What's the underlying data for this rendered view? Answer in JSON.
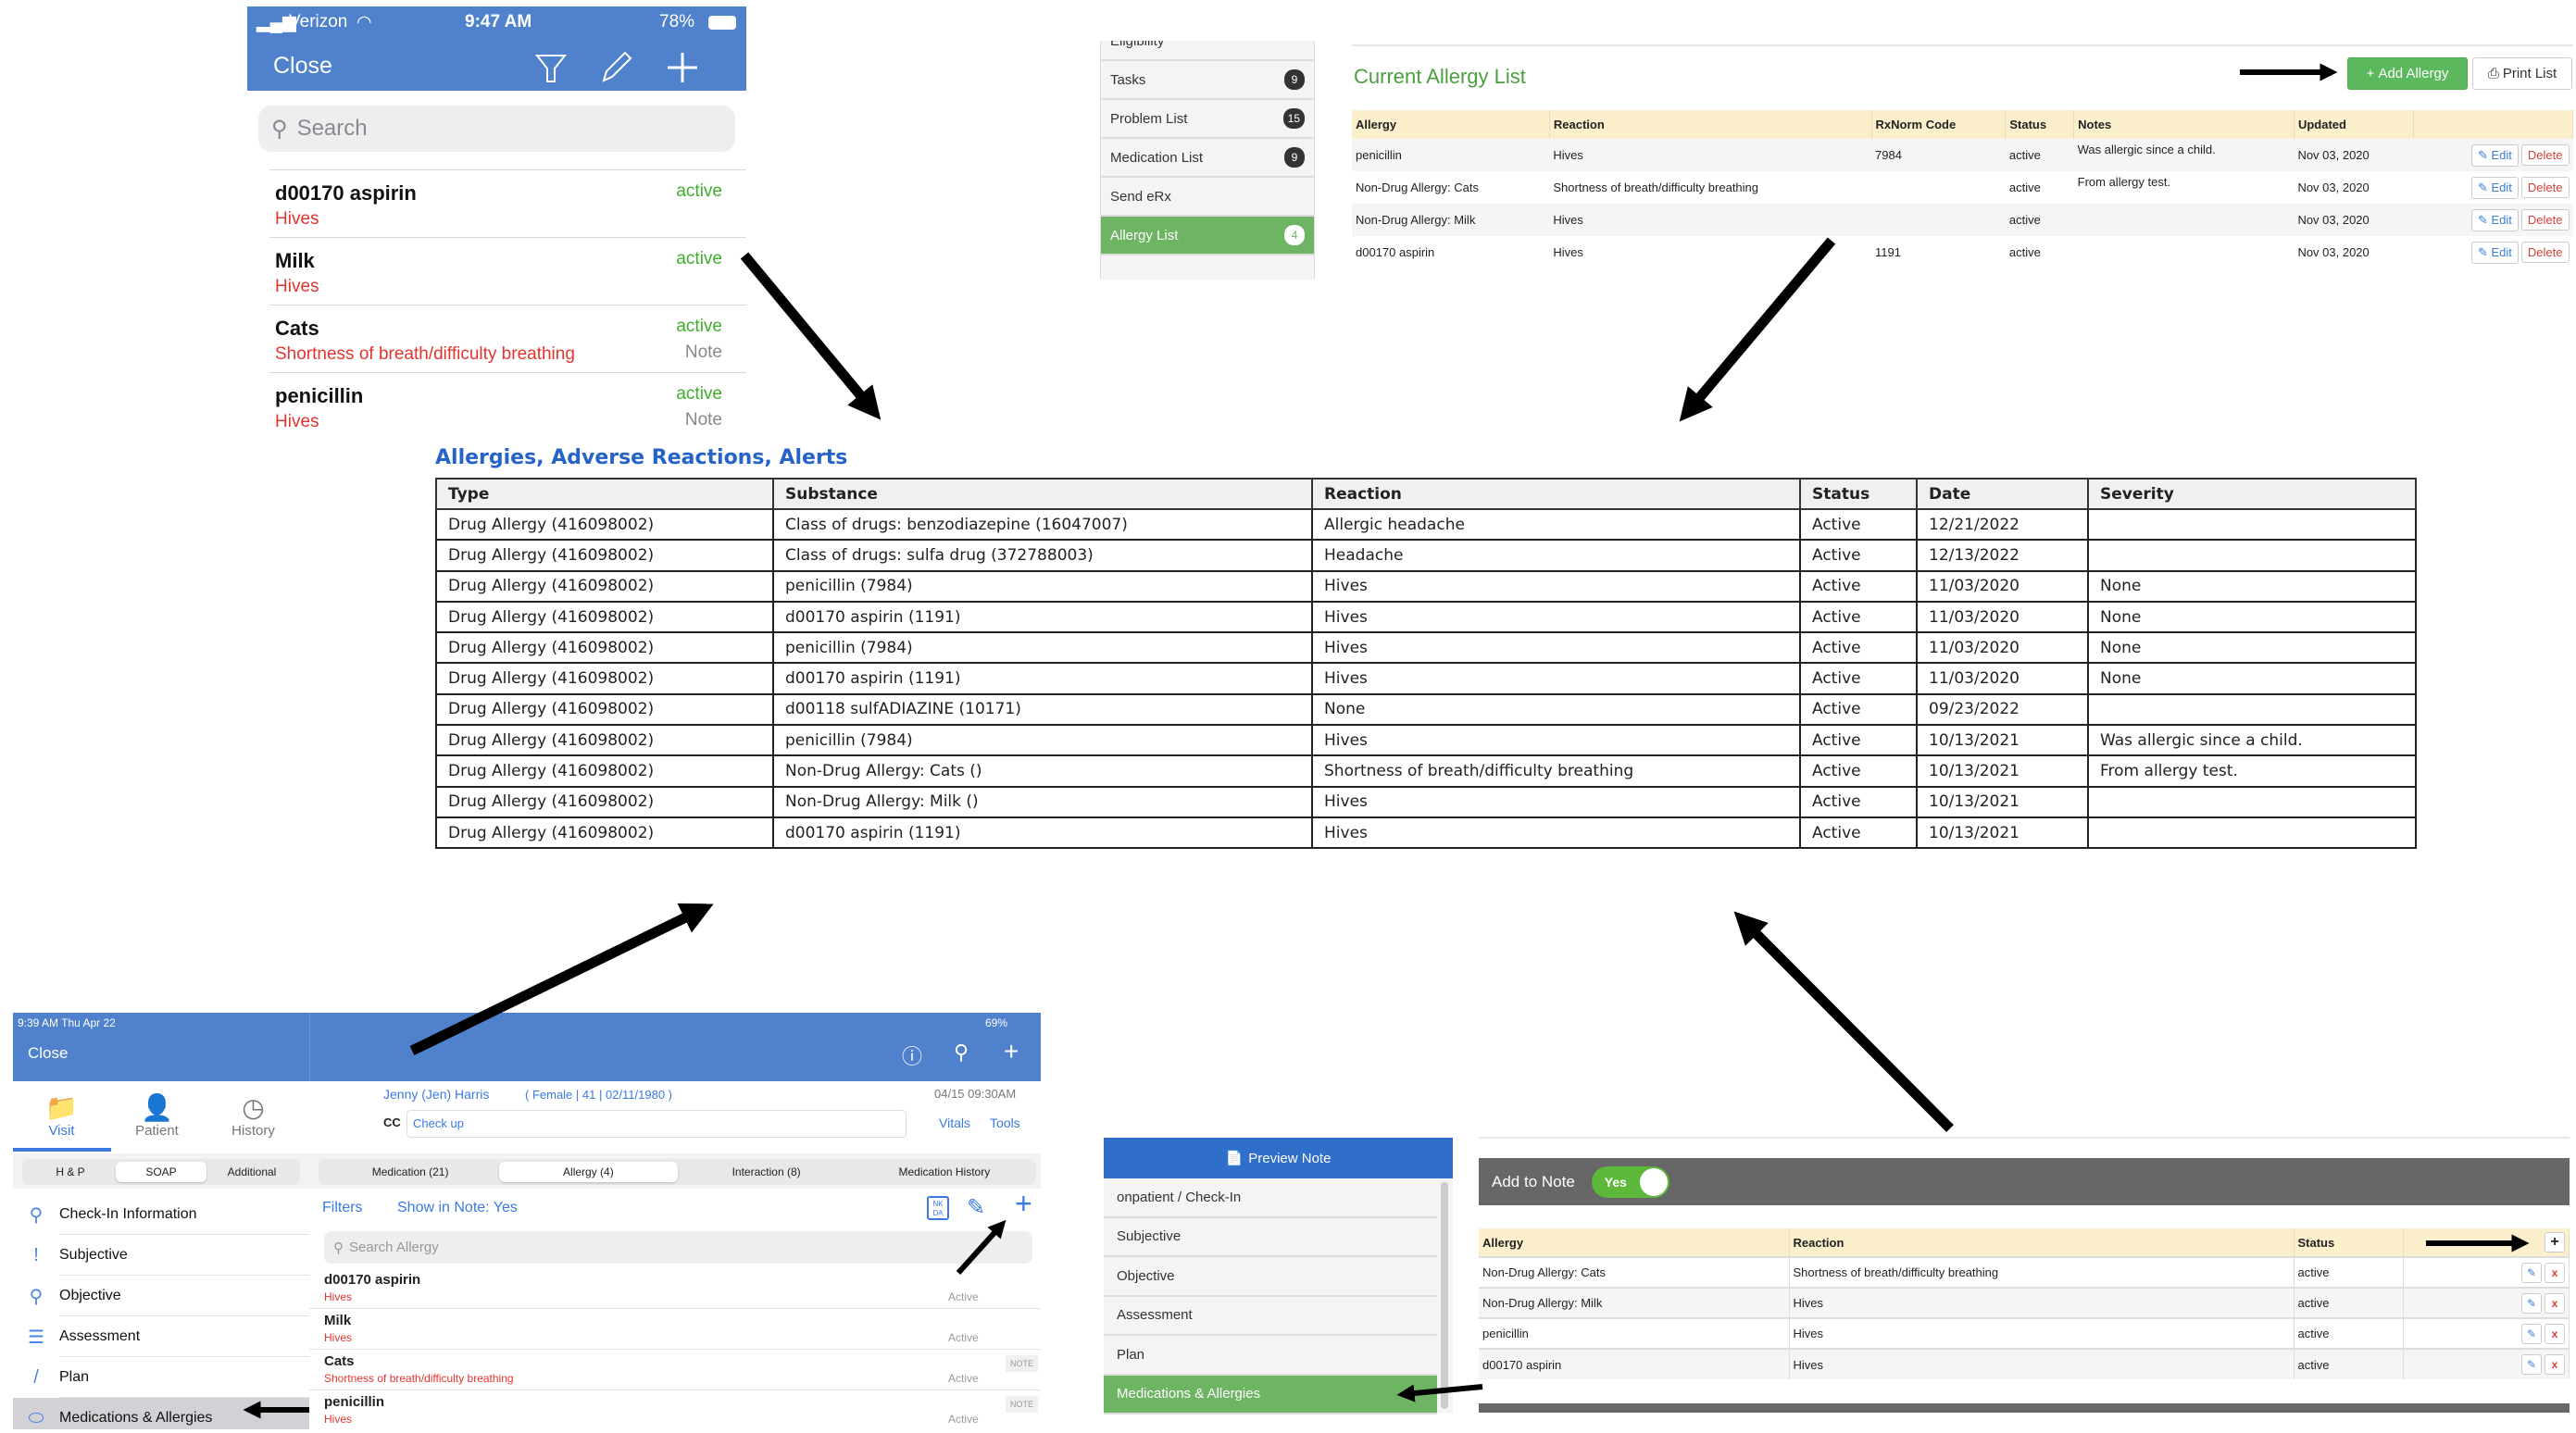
{
  "colors": {
    "ios_blue": "#4f81cc",
    "active_green": "#3fae2a",
    "reaction_red": "#e3342f",
    "web_green": "#6db463",
    "header_yellow": "#fcefcb",
    "link_blue": "#2563c9"
  },
  "phone": {
    "carrier": "Verizon",
    "time": "9:47 AM",
    "battery": "78%",
    "close": "Close",
    "icons": [
      "filter-icon",
      "pencil-icon",
      "plus-icon"
    ],
    "search_placeholder": "Search",
    "items": [
      {
        "name": "d00170 aspirin",
        "reaction": "Hives",
        "status": "active",
        "note": ""
      },
      {
        "name": "Milk",
        "reaction": "Hives",
        "status": "active",
        "note": ""
      },
      {
        "name": "Cats",
        "reaction": "Shortness of breath/difficulty breathing",
        "status": "active",
        "note": "Note"
      },
      {
        "name": "penicillin",
        "reaction": "Hives",
        "status": "active",
        "note": "Note"
      }
    ]
  },
  "web": {
    "sidebar": [
      {
        "label": "Eligibility",
        "badge": ""
      },
      {
        "label": "Tasks",
        "badge": "9"
      },
      {
        "label": "Problem List",
        "badge": "15"
      },
      {
        "label": "Medication List",
        "badge": "9"
      },
      {
        "label": "Send eRx",
        "badge": ""
      },
      {
        "label": "Allergy List",
        "badge": "4",
        "active": true
      }
    ],
    "title": "Current Allergy List",
    "add_button": "Add Allergy",
    "print_button": "Print List",
    "columns": [
      "Allergy",
      "Reaction",
      "RxNorm Code",
      "Status",
      "Notes",
      "Updated",
      ""
    ],
    "rows": [
      [
        "penicillin",
        "Hives",
        "7984",
        "active",
        "Was allergic since a child.",
        "Nov 03, 2020"
      ],
      [
        "Non-Drug Allergy: Cats",
        "Shortness of breath/difficulty breathing",
        "",
        "active",
        "From allergy test.",
        "Nov 03, 2020"
      ],
      [
        "Non-Drug Allergy: Milk",
        "Hives",
        "",
        "active",
        "",
        "Nov 03, 2020"
      ],
      [
        "d00170 aspirin",
        "Hives",
        "1191",
        "active",
        "",
        "Nov 03, 2020"
      ]
    ],
    "edit_label": "Edit",
    "delete_label": "Delete"
  },
  "summary": {
    "title": "Allergies, Adverse Reactions, Alerts",
    "columns": [
      "Type",
      "Substance",
      "Reaction",
      "Status",
      "Date",
      "Severity"
    ],
    "rows": [
      [
        "Drug Allergy (416098002)",
        "Class of drugs: benzodiazepine (16047007)",
        "Allergic headache",
        "Active",
        "12/21/2022",
        ""
      ],
      [
        "Drug Allergy (416098002)",
        "Class of drugs: sulfa drug (372788003)",
        "Headache",
        "Active",
        "12/13/2022",
        ""
      ],
      [
        "Drug Allergy (416098002)",
        "penicillin (7984)",
        "Hives",
        "Active",
        "11/03/2020",
        "None"
      ],
      [
        "Drug Allergy (416098002)",
        "d00170 aspirin (1191)",
        "Hives",
        "Active",
        "11/03/2020",
        "None"
      ],
      [
        "Drug Allergy (416098002)",
        "penicillin (7984)",
        "Hives",
        "Active",
        "11/03/2020",
        "None"
      ],
      [
        "Drug Allergy (416098002)",
        "d00170 aspirin (1191)",
        "Hives",
        "Active",
        "11/03/2020",
        "None"
      ],
      [
        "Drug Allergy (416098002)",
        "d00118 sulfADIAZINE (10171)",
        "None",
        "Active",
        "09/23/2022",
        ""
      ],
      [
        "Drug Allergy (416098002)",
        "penicillin (7984)",
        "Hives",
        "Active",
        "10/13/2021",
        "Was allergic since a child."
      ],
      [
        "Drug Allergy (416098002)",
        "Non-Drug Allergy: Cats ()",
        "Shortness of breath/difficulty breathing",
        "Active",
        "10/13/2021",
        "From allergy test."
      ],
      [
        "Drug Allergy (416098002)",
        "Non-Drug Allergy: Milk ()",
        "Hives",
        "Active",
        "10/13/2021",
        ""
      ],
      [
        "Drug Allergy (416098002)",
        "d00170 aspirin (1191)",
        "Hives",
        "Active",
        "10/13/2021",
        ""
      ]
    ]
  },
  "ipad": {
    "status_time": "9:39 AM   Thu Apr 22",
    "battery": "69%",
    "close": "Close",
    "top_tabs": [
      "Visit",
      "Patient",
      "History"
    ],
    "seg_left": [
      "H & P",
      "SOAP",
      "Additional"
    ],
    "nav": [
      {
        "label": "Check-In Information",
        "icon": "location-pin-icon"
      },
      {
        "label": "Subjective",
        "icon": "speech-bubble-icon"
      },
      {
        "label": "Objective",
        "icon": "magnifier-icon"
      },
      {
        "label": "Assessment",
        "icon": "clipboard-icon"
      },
      {
        "label": "Plan",
        "icon": "pen-icon"
      },
      {
        "label": "Medications & Allergies",
        "icon": "pill-icon"
      }
    ],
    "patient_name": "Jenny (Jen) Harris",
    "patient_info": "( Female | 41 | 02/11/1980 )",
    "visit_time": "04/15 09:30AM",
    "cc_label": "CC",
    "cc_value": "Check up",
    "vitals": "Vitals",
    "tools": "Tools",
    "seg_main": [
      "Medication (21)",
      "Allergy (4)",
      "Interaction (8)",
      "Medication History"
    ],
    "filters": "Filters",
    "show_in_note": "Show in Note: Yes",
    "nkda": "NK DA",
    "search_placeholder": "Search Allergy",
    "items": [
      {
        "name": "d00170 aspirin",
        "reaction": "Hives",
        "status": "Active",
        "note": ""
      },
      {
        "name": "Milk",
        "reaction": "Hives",
        "status": "Active",
        "note": ""
      },
      {
        "name": "Cats",
        "reaction": "Shortness of breath/difficulty breathing",
        "status": "Active",
        "note": "NOTE"
      },
      {
        "name": "penicillin",
        "reaction": "Hives",
        "status": "Active",
        "note": "NOTE"
      }
    ]
  },
  "note": {
    "preview": "Preview Note",
    "nav": [
      "onpatient / Check-In",
      "Subjective",
      "Objective",
      "Assessment",
      "Plan",
      "Medications & Allergies"
    ],
    "add_to_note": "Add to Note",
    "toggle": "Yes",
    "columns": [
      "Allergy",
      "Reaction",
      "Status"
    ],
    "rows": [
      [
        "Non-Drug Allergy: Cats",
        "Shortness of breath/difficulty breathing",
        "active"
      ],
      [
        "Non-Drug Allergy: Milk",
        "Hives",
        "active"
      ],
      [
        "penicillin",
        "Hives",
        "active"
      ],
      [
        "d00170 aspirin",
        "Hives",
        "active"
      ]
    ]
  }
}
